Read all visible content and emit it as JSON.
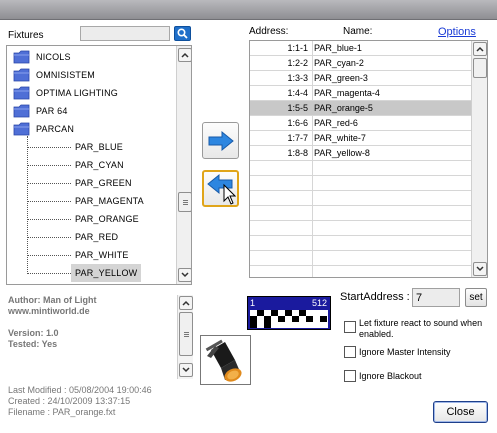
{
  "left_panel": {
    "fixtures_label": "Fixtures",
    "search_value": "",
    "tree": [
      {
        "label": "NICOLS",
        "type": "folder"
      },
      {
        "label": "OMNISISTEM",
        "type": "folder"
      },
      {
        "label": "OPTIMA LIGHTING",
        "type": "folder"
      },
      {
        "label": "PAR 64",
        "type": "folder"
      },
      {
        "label": "PARCAN",
        "type": "folder",
        "expanded": true
      },
      {
        "label": "PAR_BLUE",
        "type": "fixture"
      },
      {
        "label": "PAR_CYAN",
        "type": "fixture"
      },
      {
        "label": "PAR_GREEN",
        "type": "fixture"
      },
      {
        "label": "PAR_MAGENTA",
        "type": "fixture"
      },
      {
        "label": "PAR_ORANGE",
        "type": "fixture"
      },
      {
        "label": "PAR_RED",
        "type": "fixture"
      },
      {
        "label": "PAR_WHITE",
        "type": "fixture"
      },
      {
        "label": "PAR_YELLOW",
        "type": "fixture",
        "selected": true
      }
    ],
    "info": {
      "author": "Author: Man of Light",
      "website": "www.mintiworld.de",
      "version": "Version: 1.0",
      "tested": "Tested: Yes",
      "last_modified": "Last Modified : 05/08/2004 19:00:46",
      "created": "Created : 24/10/2009 13:37:15",
      "filename": "Filename : PAR_orange.fxt"
    }
  },
  "patch_list": {
    "address_header": "Address:",
    "name_header": "Name:",
    "options_link": "Options",
    "rows": [
      {
        "address": "1:1-1",
        "name": "PAR_blue-1"
      },
      {
        "address": "1:2-2",
        "name": "PAR_cyan-2"
      },
      {
        "address": "1:3-3",
        "name": "PAR_green-3"
      },
      {
        "address": "1:4-4",
        "name": "PAR_magenta-4"
      },
      {
        "address": "1:5-5",
        "name": "PAR_orange-5",
        "selected": true
      },
      {
        "address": "1:6-6",
        "name": "PAR_red-6"
      },
      {
        "address": "1:7-7",
        "name": "PAR_white-7"
      },
      {
        "address": "1:8-8",
        "name": "PAR_yellow-8"
      }
    ],
    "empty_rows": 8
  },
  "dmx": {
    "start_label": "1",
    "end_label": "512",
    "used_channels": 8
  },
  "start_address": {
    "label": "StartAddress :",
    "value": "7",
    "set_label": "set"
  },
  "options": [
    {
      "label": "Let fixture react to sound when enabled.",
      "checked": false
    },
    {
      "label": "Ignore Master Intensity",
      "checked": false
    },
    {
      "label": "Ignore Blackout",
      "checked": false
    }
  ],
  "close_label": "Close",
  "colors": {
    "accent_blue": "#1f6fc9",
    "dmx_bar": "#1a1a9e",
    "folder": "#4f6fd6",
    "selected_row": "#c8c8c8"
  }
}
